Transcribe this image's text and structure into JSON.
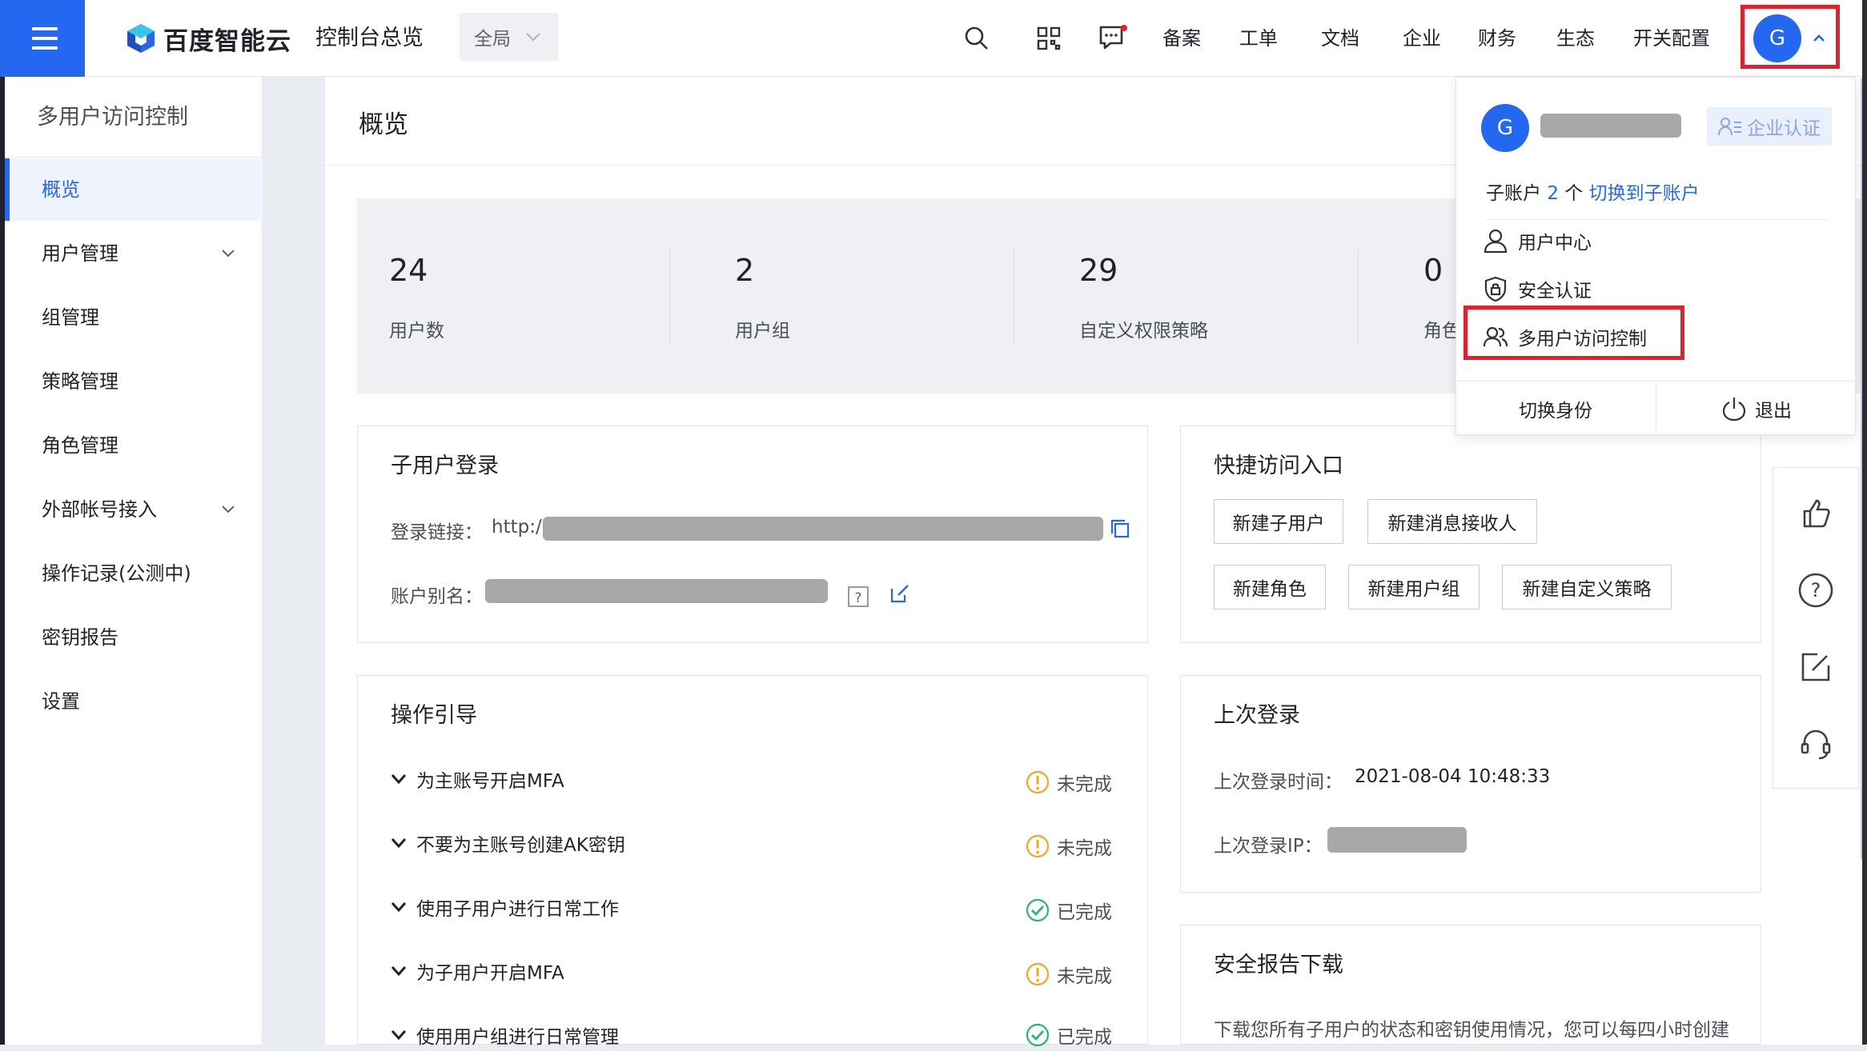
{
  "header": {
    "brand": "百度智能云",
    "console_title": "控制台总览",
    "region": "全局",
    "nav": [
      "备案",
      "工单",
      "文档",
      "企业",
      "财务",
      "生态",
      "开关配置"
    ],
    "avatar_letter": "G",
    "icons": [
      "menu-icon",
      "search-icon",
      "qrcode-icon",
      "message-icon",
      "chevron-up-icon"
    ]
  },
  "sidebar": {
    "title": "多用户访问控制",
    "items": [
      {
        "label": "概览",
        "active": true
      },
      {
        "label": "用户管理",
        "expandable": true
      },
      {
        "label": "组管理"
      },
      {
        "label": "策略管理"
      },
      {
        "label": "角色管理"
      },
      {
        "label": "外部帐号接入",
        "expandable": true
      },
      {
        "label": "操作记录(公测中)"
      },
      {
        "label": "密钥报告"
      },
      {
        "label": "设置"
      }
    ]
  },
  "page": {
    "title": "概览",
    "stats": [
      {
        "value": "24",
        "label": "用户数"
      },
      {
        "value": "2",
        "label": "用户组"
      },
      {
        "value": "29",
        "label": "自定义权限策略"
      },
      {
        "value": "0",
        "label": "角色"
      }
    ],
    "login_card": {
      "title": "子用户登录",
      "link_label": "登录链接：",
      "link_prefix": "http:/",
      "alias_label": "账户别名："
    },
    "quick_card": {
      "title": "快捷访问入口",
      "buttons": [
        "新建子用户",
        "新建消息接收人",
        "新建角色",
        "新建用户组",
        "新建自定义策略"
      ]
    },
    "guide_card": {
      "title": "操作引导",
      "items": [
        {
          "label": "为主账号开启MFA",
          "status": "未完成",
          "done": false
        },
        {
          "label": "不要为主账号创建AK密钥",
          "status": "未完成",
          "done": false
        },
        {
          "label": "使用子用户进行日常工作",
          "status": "已完成",
          "done": true
        },
        {
          "label": "为子用户开启MFA",
          "status": "未完成",
          "done": false
        },
        {
          "label": "使用用户组进行日常管理",
          "status": "已完成",
          "done": true
        }
      ]
    },
    "last_login_card": {
      "title": "上次登录",
      "time_label": "上次登录时间：",
      "time_value": "2021-08-04 10:48:33",
      "ip_label": "上次登录IP："
    },
    "report_card": {
      "title": "安全报告下载",
      "text": "下载您所有子用户的状态和密钥使用情况，您可以每四小时创建"
    }
  },
  "dropdown": {
    "avatar_letter": "G",
    "verify_label": "企业认证",
    "sub_prefix": "子账户",
    "sub_count": "2",
    "sub_unit": "个",
    "switch_link": "切换到子账户",
    "items": [
      "用户中心",
      "安全认证",
      "多用户访问控制"
    ],
    "switch_identity": "切换身份",
    "logout": "退出"
  },
  "colors": {
    "primary": "#2468f2",
    "highlight": "#e5202e",
    "warning": "#f5a623",
    "success": "#2bb673"
  }
}
